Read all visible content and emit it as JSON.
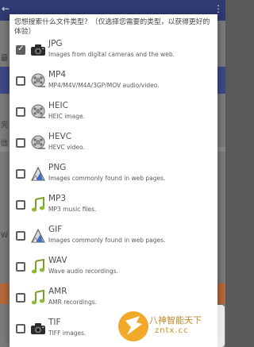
{
  "dialog": {
    "title": "您想搜索什么文件类型？（仅选择您需要的类型，以获得更好的体验）"
  },
  "file_types": [
    {
      "label": "JPG",
      "desc": "Images from digital cameras and the web.",
      "checked": true,
      "icon": "camera-icon"
    },
    {
      "label": "MP4",
      "desc": "MP4/M4V/M4A/3GP/MOV audio/video.",
      "checked": false,
      "icon": "film-reel-icon"
    },
    {
      "label": "HEIC",
      "desc": "HEIC image.",
      "checked": false,
      "icon": "film-reel-icon"
    },
    {
      "label": "HEVC",
      "desc": "HEVC video.",
      "checked": false,
      "icon": "film-reel-icon"
    },
    {
      "label": "PNG",
      "desc": "Images commonly found in web pages.",
      "checked": false,
      "icon": "drawing-icon"
    },
    {
      "label": "MP3",
      "desc": "MP3 music files.",
      "checked": false,
      "icon": "music-note-icon"
    },
    {
      "label": "GIF",
      "desc": "Images commonly found in web pages.",
      "checked": false,
      "icon": "drawing-icon"
    },
    {
      "label": "WAV",
      "desc": "Wave audio recordings.",
      "checked": false,
      "icon": "music-note-icon"
    },
    {
      "label": "AMR",
      "desc": "AMR recordings.",
      "checked": false,
      "icon": "music-note-icon"
    },
    {
      "label": "TIF",
      "desc": "TIFF images.",
      "checked": false,
      "icon": "camera-icon"
    }
  ],
  "background": {
    "left_chars": [
      "最",
      "完",
      "信",
      "W"
    ]
  },
  "watermark": {
    "line1": "八神智能天下",
    "line2": "zntx.cc"
  }
}
